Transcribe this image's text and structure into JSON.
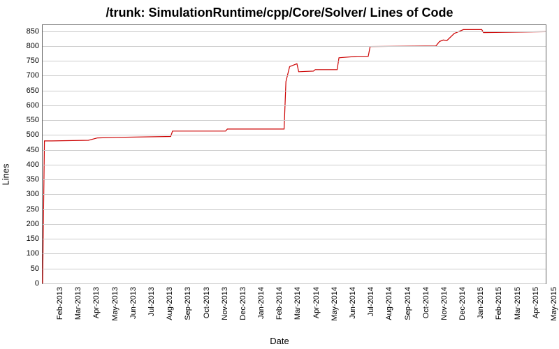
{
  "chart_data": {
    "type": "line",
    "title": "/trunk: SimulationRuntime/cpp/Core/Solver/ Lines of Code",
    "xlabel": "Date",
    "ylabel": "Lines",
    "ylim": [
      0,
      870
    ],
    "yticks": [
      0,
      50,
      100,
      150,
      200,
      250,
      300,
      350,
      400,
      450,
      500,
      550,
      600,
      650,
      700,
      750,
      800,
      850
    ],
    "x_categories": [
      "Feb-2013",
      "Mar-2013",
      "Apr-2013",
      "May-2013",
      "Jun-2013",
      "Jul-2013",
      "Aug-2013",
      "Sep-2013",
      "Oct-2013",
      "Nov-2013",
      "Dec-2013",
      "Jan-2014",
      "Feb-2014",
      "Mar-2014",
      "Apr-2014",
      "May-2014",
      "Jun-2014",
      "Jul-2014",
      "Aug-2014",
      "Sep-2014",
      "Oct-2014",
      "Nov-2014",
      "Dec-2014",
      "Jan-2015",
      "Feb-2015",
      "Mar-2015",
      "Apr-2015",
      "May-2015"
    ],
    "series": [
      {
        "name": "Lines of Code",
        "color": "#cc0000",
        "points": [
          {
            "xi": -0.5,
            "y": 0
          },
          {
            "xi": -0.4,
            "y": 480
          },
          {
            "xi": 0.0,
            "y": 480
          },
          {
            "xi": 2.0,
            "y": 482
          },
          {
            "xi": 2.5,
            "y": 490
          },
          {
            "xi": 3.5,
            "y": 492
          },
          {
            "xi": 6.5,
            "y": 495
          },
          {
            "xi": 6.6,
            "y": 513
          },
          {
            "xi": 9.5,
            "y": 513
          },
          {
            "xi": 9.6,
            "y": 520
          },
          {
            "xi": 12.7,
            "y": 520
          },
          {
            "xi": 12.8,
            "y": 680
          },
          {
            "xi": 13.0,
            "y": 730
          },
          {
            "xi": 13.4,
            "y": 740
          },
          {
            "xi": 13.5,
            "y": 713
          },
          {
            "xi": 14.3,
            "y": 715
          },
          {
            "xi": 14.4,
            "y": 720
          },
          {
            "xi": 15.6,
            "y": 720
          },
          {
            "xi": 15.7,
            "y": 760
          },
          {
            "xi": 16.7,
            "y": 765
          },
          {
            "xi": 17.3,
            "y": 765
          },
          {
            "xi": 17.4,
            "y": 798
          },
          {
            "xi": 21.0,
            "y": 800
          },
          {
            "xi": 21.2,
            "y": 815
          },
          {
            "xi": 21.4,
            "y": 820
          },
          {
            "xi": 21.6,
            "y": 818
          },
          {
            "xi": 22.0,
            "y": 842
          },
          {
            "xi": 22.5,
            "y": 855
          },
          {
            "xi": 23.5,
            "y": 855
          },
          {
            "xi": 23.6,
            "y": 845
          },
          {
            "xi": 27.0,
            "y": 848
          }
        ]
      }
    ]
  }
}
